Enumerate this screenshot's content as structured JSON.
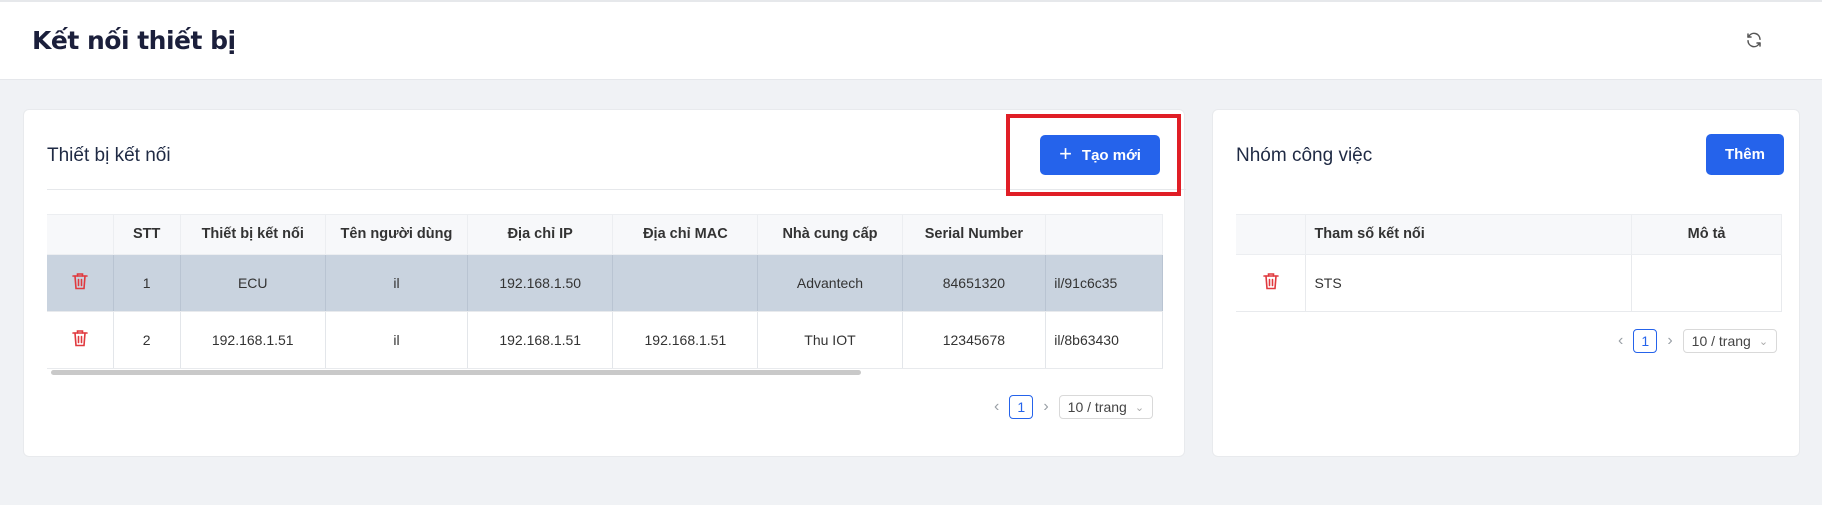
{
  "header": {
    "title": "Kết nối thiết bị",
    "refresh_icon": "refresh-icon"
  },
  "devices": {
    "title": "Thiết bị kết nối",
    "create_label": "Tạo mới",
    "columns": [
      "",
      "STT",
      "Thiết bị kết nối",
      "Tên người dùng",
      "Địa chỉ IP",
      "Địa chỉ MAC",
      "Nhà cung cấp",
      "Serial Number",
      ""
    ],
    "rows": [
      {
        "stt": "1",
        "device": "ECU",
        "user": "il",
        "ip": "192.168.1.50",
        "mac": "",
        "vendor": "Advantech",
        "serial": "84651320",
        "extra": "il/91c6c35"
      },
      {
        "stt": "2",
        "device": "192.168.1.51",
        "user": "il",
        "ip": "192.168.1.51",
        "mac": "192.168.1.51",
        "vendor": "Thu IOT",
        "serial": "12345678",
        "extra": "il/8b63430"
      }
    ],
    "pagination": {
      "current_page": "1",
      "page_size": "10 / trang"
    }
  },
  "groups": {
    "title": "Nhóm công việc",
    "add_label": "Thêm",
    "columns": [
      "",
      "Tham số kết nối",
      "Mô tả"
    ],
    "rows": [
      {
        "param": "STS",
        "desc": ""
      }
    ],
    "pagination": {
      "current_page": "1",
      "page_size": "10 / trang"
    }
  },
  "colors": {
    "primary": "#2563eb",
    "highlight": "#e01e26",
    "delete": "#e0393e",
    "selected_row": "#c9d3df"
  }
}
